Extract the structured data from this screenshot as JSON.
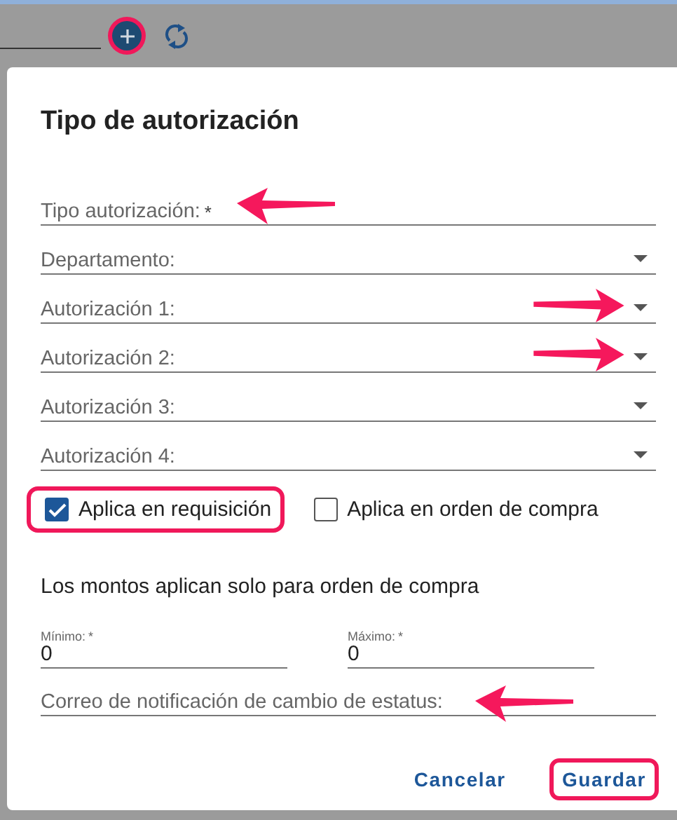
{
  "toolbar": {
    "add_button": {
      "highlighted": true
    }
  },
  "dialog": {
    "title": "Tipo de autorización",
    "fields": [
      {
        "label": "Tipo autorización:",
        "required_mark": "*",
        "kind": "text",
        "annotated": true
      },
      {
        "label": "Departamento:",
        "kind": "select",
        "annotated": false
      },
      {
        "label": "Autorización 1:",
        "kind": "select",
        "annotated": true
      },
      {
        "label": "Autorización 2:",
        "kind": "select",
        "annotated": true
      },
      {
        "label": "Autorización 3:",
        "kind": "select",
        "annotated": false
      },
      {
        "label": "Autorización 4:",
        "kind": "select",
        "annotated": false
      }
    ],
    "checkboxes": [
      {
        "label": "Aplica en requisición",
        "checked": true,
        "highlighted": true
      },
      {
        "label": "Aplica en orden de compra",
        "checked": false,
        "highlighted": false
      }
    ],
    "note": "Los montos aplican solo para orden de compra",
    "amounts": [
      {
        "label": "Mínimo:",
        "required_mark": "*",
        "value": "0"
      },
      {
        "label": "Máximo:",
        "required_mark": "*",
        "value": "0"
      }
    ],
    "email_field": {
      "label": "Correo de notificación de cambio de estatus:",
      "annotated": true
    },
    "buttons": [
      {
        "label": "Cancelar",
        "highlighted": false
      },
      {
        "label": "Guardar",
        "highlighted": true
      }
    ]
  }
}
